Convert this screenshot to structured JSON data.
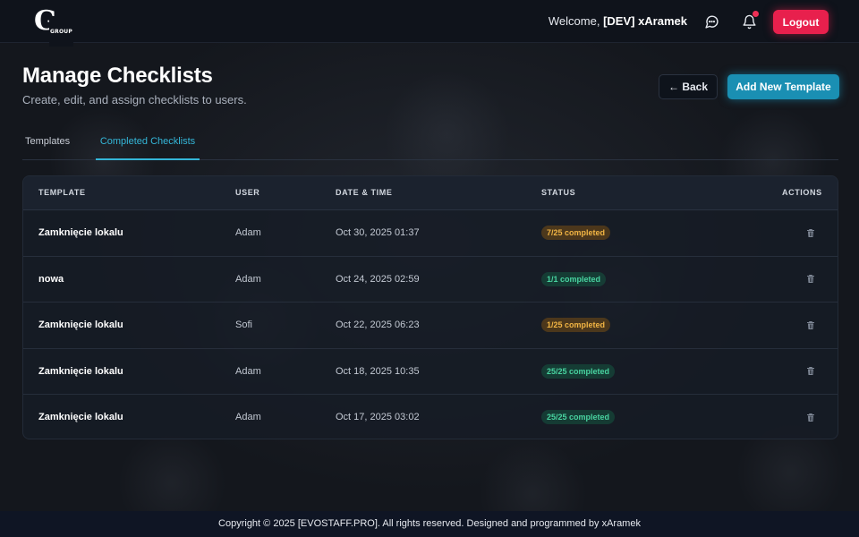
{
  "navbar": {
    "logo_letter": "G",
    "logo_sub": "GROUP",
    "welcome_prefix": "Welcome, ",
    "username": "[DEV] xAramek",
    "logout_label": "Logout"
  },
  "header": {
    "title": "Manage Checklists",
    "subtitle": "Create, edit, and assign checklists to users.",
    "back_label": "← Back",
    "add_label": "Add New Template"
  },
  "tabs": [
    {
      "label": "Templates",
      "active": false
    },
    {
      "label": "Completed Checklists",
      "active": true
    }
  ],
  "table": {
    "columns": [
      "TEMPLATE",
      "USER",
      "DATE & TIME",
      "STATUS",
      "ACTIONS"
    ],
    "rows": [
      {
        "template": "Zamknięcie lokalu",
        "user": "Adam",
        "datetime": "Oct 30, 2025 01:37",
        "status": "7/25 completed",
        "state": "partial"
      },
      {
        "template": "nowa",
        "user": "Adam",
        "datetime": "Oct 24, 2025 02:59",
        "status": "1/1 completed",
        "state": "done"
      },
      {
        "template": "Zamknięcie lokalu",
        "user": "Sofi",
        "datetime": "Oct 22, 2025 06:23",
        "status": "1/25 completed",
        "state": "partial"
      },
      {
        "template": "Zamknięcie lokalu",
        "user": "Adam",
        "datetime": "Oct 18, 2025 10:35",
        "status": "25/25 completed",
        "state": "done"
      },
      {
        "template": "Zamknięcie lokalu",
        "user": "Adam",
        "datetime": "Oct 17, 2025 03:02",
        "status": "25/25 completed",
        "state": "done"
      }
    ]
  },
  "footer": {
    "text": "Copyright © 2025 [EVOSTAFF.PRO]. All rights reserved. Designed and programmed by xAramek"
  },
  "colors": {
    "accent": "#34b6d8",
    "logout": "#e8204d",
    "add_button": "#1a8fb3",
    "status_partial": "#f2b544",
    "status_done": "#48d3a0"
  }
}
